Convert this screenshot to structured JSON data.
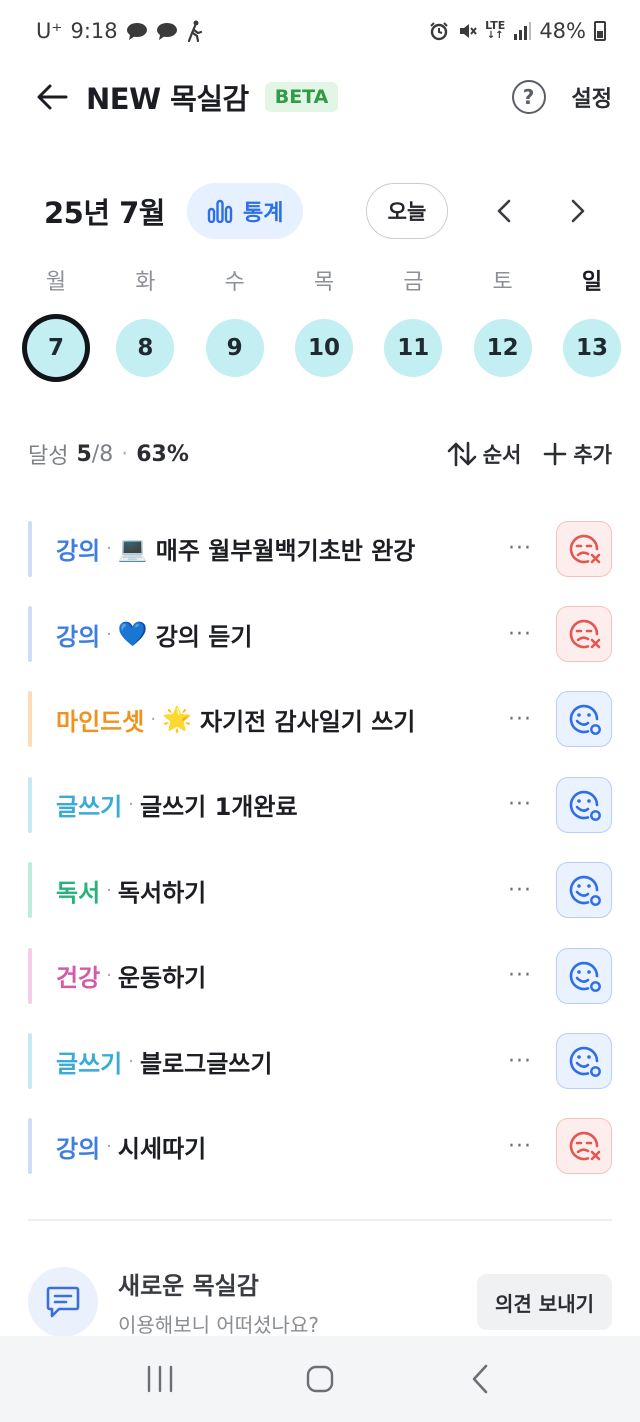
{
  "status_bar": {
    "carrier": "U⁺",
    "time": "9:18",
    "network": "LTE",
    "battery": "48%"
  },
  "header": {
    "title": "NEW 목실감",
    "badge": "BETA",
    "help_label": "?",
    "settings_label": "설정"
  },
  "calendar": {
    "month_label": "25년 7월",
    "stats_label": "통계",
    "today_label": "오늘",
    "weekdays": [
      "월",
      "화",
      "수",
      "목",
      "금",
      "토",
      "일"
    ],
    "dates": [
      "7",
      "8",
      "9",
      "10",
      "11",
      "12",
      "13"
    ],
    "selected_index": 0
  },
  "summary": {
    "label": "달성",
    "done": "5",
    "total": "/8",
    "separator": "·",
    "percent": "63%",
    "sort_label": "순서",
    "add_label": "추가"
  },
  "tasks": [
    {
      "category": "강의",
      "emoji": "💻",
      "title": "매주 월부월백기초반 완강",
      "cat_color": "#3f7de0",
      "bar_color": "#cfdcf7",
      "mood": "bad"
    },
    {
      "category": "강의",
      "emoji": "💙",
      "title": "강의 듣기",
      "cat_color": "#3f7de0",
      "bar_color": "#cfdcf7",
      "mood": "bad"
    },
    {
      "category": "마인드셋",
      "emoji": "🌟",
      "title": "자기전 감사일기 쓰기",
      "cat_color": "#f0931e",
      "bar_color": "#fbdcb6",
      "mood": "good"
    },
    {
      "category": "글쓰기",
      "emoji": "",
      "title": "글쓰기 1개완료",
      "cat_color": "#3aaad6",
      "bar_color": "#c6e9f6",
      "mood": "good"
    },
    {
      "category": "독서",
      "emoji": "",
      "title": "독서하기",
      "cat_color": "#24b37a",
      "bar_color": "#bfeddb",
      "mood": "good"
    },
    {
      "category": "건강",
      "emoji": "",
      "title": "운동하기",
      "cat_color": "#d45aa6",
      "bar_color": "#f6cde6",
      "mood": "good"
    },
    {
      "category": "글쓰기",
      "emoji": "",
      "title": "블로그글쓰기",
      "cat_color": "#3aaad6",
      "bar_color": "#c6e9f6",
      "mood": "good"
    },
    {
      "category": "강의",
      "emoji": "",
      "title": "시세따기",
      "cat_color": "#3f7de0",
      "bar_color": "#cfdcf7",
      "mood": "bad"
    }
  ],
  "task_separator": "·",
  "more_label": "···",
  "feedback": {
    "title": "새로운 목실감",
    "subtitle": "이용해보니 어떠셨나요?",
    "button_label": "의견 보내기"
  },
  "colors": {
    "accent": "#2e6ee8",
    "date_bg": "#c3eef2",
    "bad_mood": "#e4574e",
    "good_mood": "#2e6ee8"
  }
}
